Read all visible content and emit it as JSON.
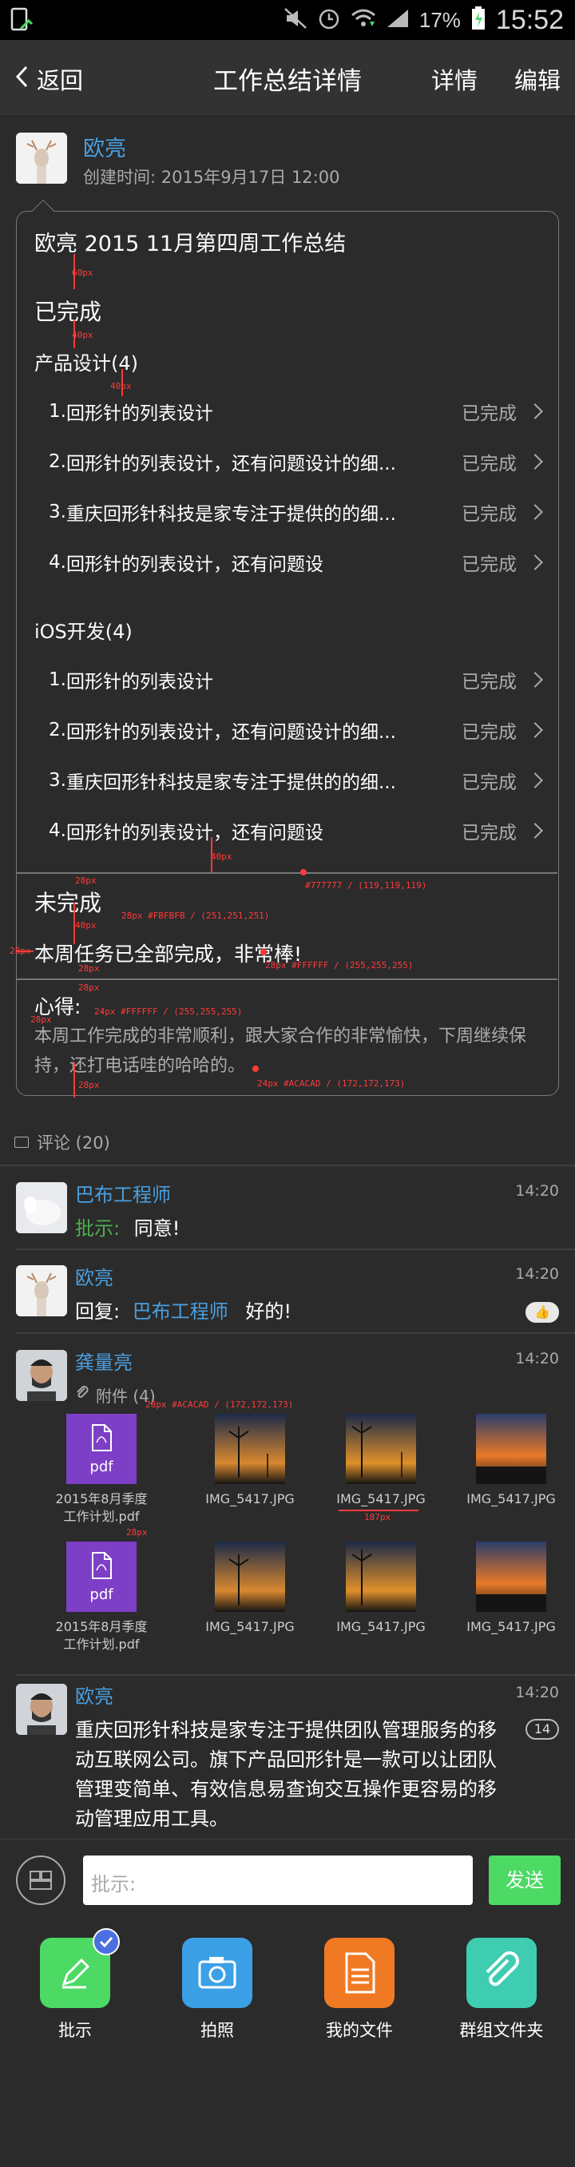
{
  "status_bar": {
    "battery_pct": "17%",
    "time": "15:52"
  },
  "nav": {
    "back_label": "返回",
    "title": "工作总结详情",
    "details_label": "详情",
    "edit_label": "编辑"
  },
  "author": {
    "name": "欧亮",
    "created": "创建时间: 2015年9月17日 12:00"
  },
  "summary": {
    "title": "欧亮 2015 11月第四周工作总结",
    "done_title": "已完成",
    "groups": [
      {
        "title": "产品设计(4)",
        "items": [
          {
            "num": "1.",
            "text": "回形针的列表设计",
            "status": "已完成"
          },
          {
            "num": "2.",
            "text": "回形针的列表设计，还有问题设计的细...",
            "status": "已完成"
          },
          {
            "num": "3.",
            "text": "重庆回形针科技是家专注于提供的的细...",
            "status": "已完成"
          },
          {
            "num": "4.",
            "text": "回形针的列表设计，还有问题设",
            "status": "已完成"
          }
        ]
      },
      {
        "title": "iOS开发(4)",
        "items": [
          {
            "num": "1.",
            "text": "回形针的列表设计",
            "status": "已完成"
          },
          {
            "num": "2.",
            "text": "回形针的列表设计，还有问题设计的细...",
            "status": "已完成"
          },
          {
            "num": "3.",
            "text": "重庆回形针科技是家专注于提供的的细...",
            "status": "已完成"
          },
          {
            "num": "4.",
            "text": "回形针的列表设计，还有问题设",
            "status": "已完成"
          }
        ]
      }
    ],
    "undone_title": "未完成",
    "undone_text": "本周任务已全部完成，非常棒!",
    "thoughts_title": "心得:",
    "thoughts_text": "本周工作完成的非常顺利，跟大家合作的非常愉快，下周继续保持，还打电话哇的哈哈的。"
  },
  "annotations": {
    "a1": "60px",
    "a2": "40px",
    "a3": "40px",
    "a4": "40px",
    "a5": "#777777 / (119,119,119)",
    "a6": "28px",
    "a7": "28px #FBFBFB / (251,251,251)",
    "a8": "40px",
    "a9": "28px",
    "a10": "28px #FFFFFF / (255,255,255)",
    "a11": "28px",
    "a12": "24px #FFFFFF / (255,255,255)",
    "a13": "28px",
    "a14": "24px #ACACAD / (172,172,173)",
    "a15": "28px",
    "a16": "28px #ACACAD / (172,172,173)",
    "a17": "28px",
    "a18": "187px",
    "a19": "28px"
  },
  "comments_header": "评论 (20)",
  "comments": [
    {
      "name": "巴布工程师",
      "time": "14:20",
      "label": "批示:",
      "text": "同意!"
    },
    {
      "name": "欧亮",
      "time": "14:20",
      "prefix": "回复:",
      "link": "巴布工程师",
      "text": "好的!"
    },
    {
      "name": "龚量亮",
      "time": "14:20",
      "attach_label": "附件 (4)",
      "attachments": [
        {
          "type": "pdf",
          "label": "pdf",
          "name": "2015年8月季度\n工作计划.pdf"
        },
        {
          "type": "image",
          "name": "IMG_5417.JPG"
        },
        {
          "type": "image",
          "name": "IMG_5417.JPG"
        },
        {
          "type": "image",
          "name": "IMG_5417.JPG"
        },
        {
          "type": "pdf",
          "label": "pdf",
          "name": "2015年8月季度\n工作计划.pdf"
        },
        {
          "type": "image",
          "name": "IMG_5417.JPG"
        },
        {
          "type": "image",
          "name": "IMG_5417.JPG"
        },
        {
          "type": "image",
          "name": "IMG_5417.JPG"
        }
      ]
    },
    {
      "name": "欧亮",
      "time": "14:20",
      "badge": "14",
      "text": "重庆回形针科技是家专注于提供团队管理服务的移动互联网公司。旗下产品回形针是一款可以让团队管理变简单、有效信息易查询交互操作更容易的移动管理应用工具。"
    }
  ],
  "input": {
    "placeholder": "批示:",
    "send_label": "发送"
  },
  "actions": [
    {
      "label": "批示",
      "color": "#4cd964"
    },
    {
      "label": "拍照",
      "color": "#3ba0e6"
    },
    {
      "label": "我的文件",
      "color": "#f07a24"
    },
    {
      "label": "群组文件夹",
      "color": "#3ecdb0"
    }
  ]
}
